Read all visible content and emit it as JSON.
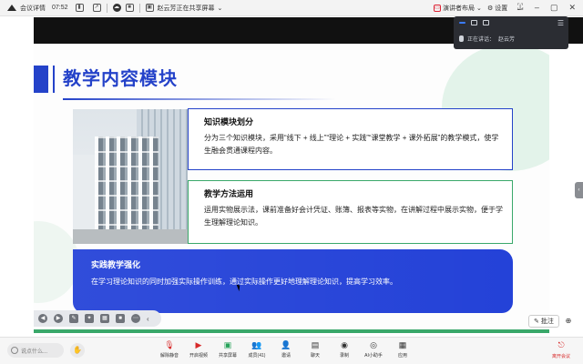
{
  "topbar": {
    "meeting_label": "会议详情",
    "time": "07:52",
    "sharing_label": "赵云芳正在共享屏幕",
    "layout_label": "演讲者布局",
    "settings_label": "设置"
  },
  "slide": {
    "title": "教学内容模块",
    "card1": {
      "title": "知识模块划分",
      "body": "分为三个知识模块，采用“线下 + 线上”“理论 + 实践”“课堂教学 + 课外拓展”的教学模式，使学生融会贯通课程内容。"
    },
    "card2": {
      "title": "教学方法运用",
      "body": "运用实物展示法，课前准备好会计凭证、账簿、报表等实物，在讲解过程中展示实物，便于学生理解理论知识。"
    },
    "card3": {
      "title": "实践教学强化",
      "body": "在学习理论知识的同时加强实际操作训练，通过实际操作更好地理解理论知识，提高学习效率。"
    }
  },
  "annotation": {
    "label": "批注"
  },
  "float_panel": {
    "speaking_label": "正在讲话：",
    "speaker": "赵云芳"
  },
  "bottombar": {
    "chat_placeholder": "说点什么...",
    "tools": [
      {
        "label": "解除静音",
        "icon": "mic-off-icon"
      },
      {
        "label": "开启视频",
        "icon": "video-off-icon"
      },
      {
        "label": "共享屏幕",
        "icon": "share-screen-icon"
      },
      {
        "label": "成员(41)",
        "icon": "members-icon"
      },
      {
        "label": "邀请",
        "icon": "invite-icon"
      },
      {
        "label": "聊天",
        "icon": "chat-icon"
      },
      {
        "label": "录制",
        "icon": "record-icon"
      },
      {
        "label": "AI小助手",
        "icon": "ai-assistant-icon"
      },
      {
        "label": "应用",
        "icon": "apps-icon"
      }
    ],
    "leave_label": "离开会议"
  }
}
